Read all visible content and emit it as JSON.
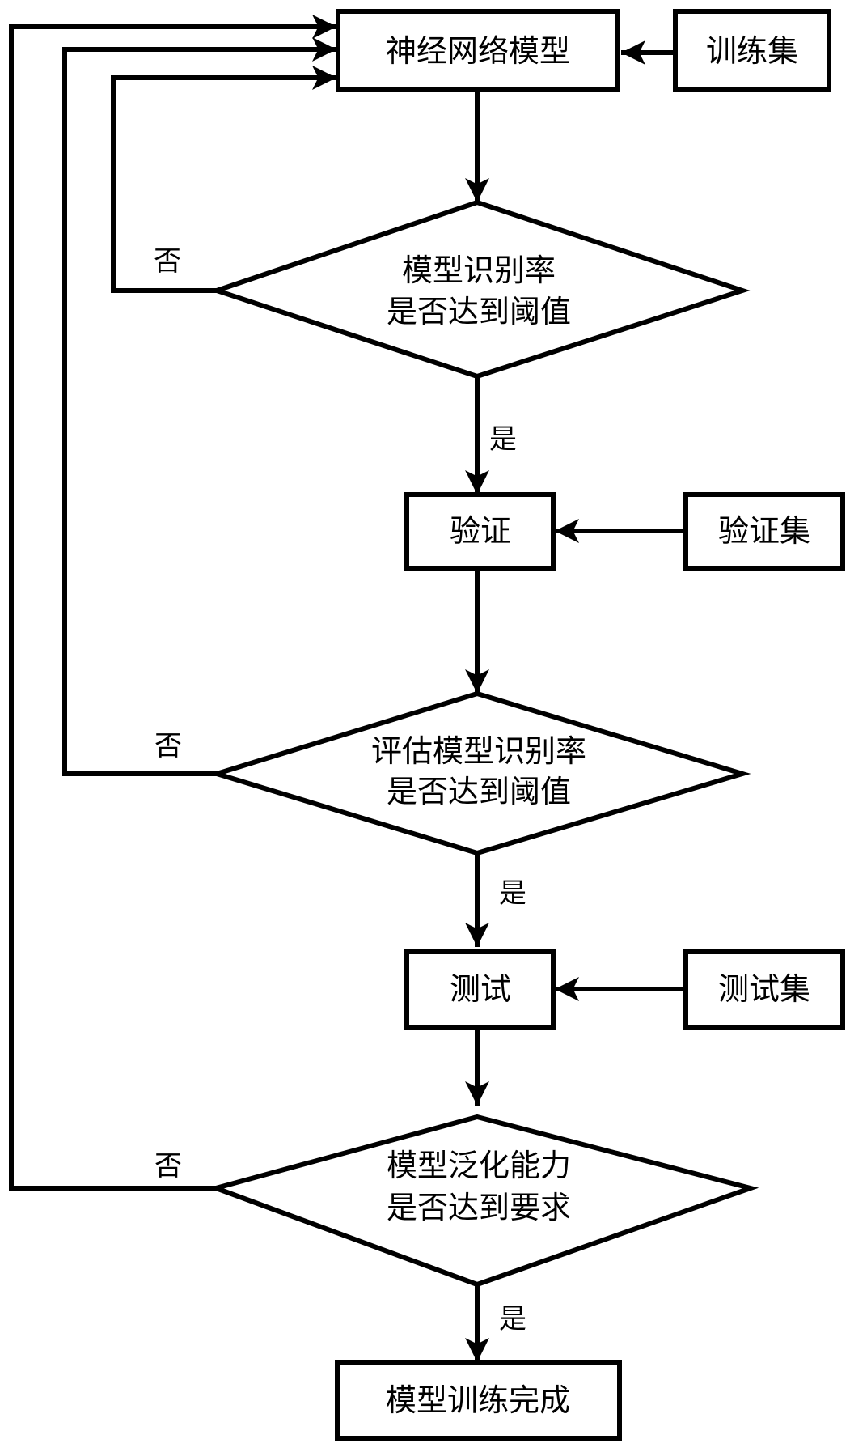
{
  "diagram": {
    "type": "flowchart",
    "colors": {
      "stroke": "#000000",
      "fill": "#ffffff",
      "text": "#000000"
    },
    "nodes": {
      "nn_model": {
        "label": "神经网络模型",
        "shape": "rect"
      },
      "training_set": {
        "label": "训练集",
        "shape": "rect"
      },
      "decision_recognition": {
        "lines": [
          "模型识别率",
          "是否达到阈值"
        ],
        "shape": "diamond"
      },
      "validate": {
        "label": "验证",
        "shape": "rect"
      },
      "validation_set": {
        "label": "验证集",
        "shape": "rect"
      },
      "decision_evaluate": {
        "lines": [
          "评估模型识别率",
          "是否达到阈值"
        ],
        "shape": "diamond"
      },
      "test": {
        "label": "测试",
        "shape": "rect"
      },
      "test_set": {
        "label": "测试集",
        "shape": "rect"
      },
      "decision_generalization": {
        "lines": [
          "模型泛化能力",
          "是否达到要求"
        ],
        "shape": "diamond"
      },
      "done": {
        "label": "模型训练完成",
        "shape": "rect"
      }
    },
    "edges": [
      {
        "from": "training_set",
        "to": "nn_model",
        "label": ""
      },
      {
        "from": "nn_model",
        "to": "decision_recognition",
        "label": ""
      },
      {
        "from": "decision_recognition",
        "to": "validate",
        "label": "是"
      },
      {
        "from": "decision_recognition",
        "to": "nn_model",
        "label": "否"
      },
      {
        "from": "validation_set",
        "to": "validate",
        "label": ""
      },
      {
        "from": "validate",
        "to": "decision_evaluate",
        "label": ""
      },
      {
        "from": "decision_evaluate",
        "to": "test",
        "label": "是"
      },
      {
        "from": "decision_evaluate",
        "to": "nn_model",
        "label": "否"
      },
      {
        "from": "test_set",
        "to": "test",
        "label": ""
      },
      {
        "from": "test",
        "to": "decision_generalization",
        "label": ""
      },
      {
        "from": "decision_generalization",
        "to": "done",
        "label": "是"
      },
      {
        "from": "decision_generalization",
        "to": "nn_model",
        "label": "否"
      }
    ],
    "edge_labels": {
      "yes": "是",
      "no": "否"
    }
  }
}
